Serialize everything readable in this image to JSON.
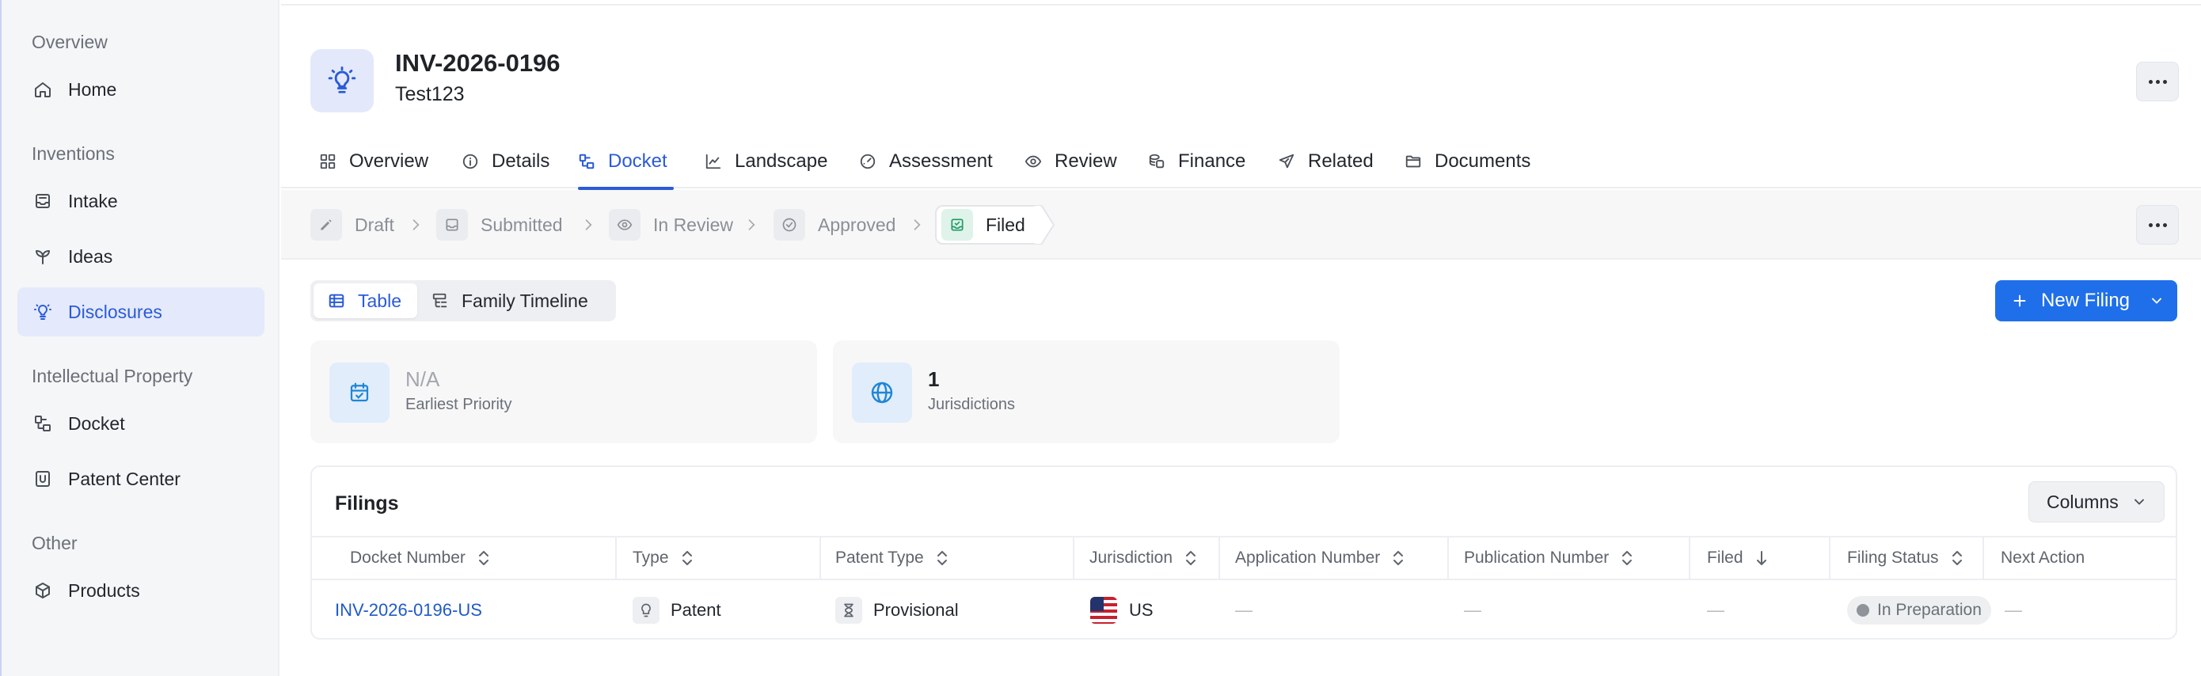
{
  "sidebar": {
    "sections": [
      "Overview",
      "Inventions",
      "Intellectual Property",
      "Other"
    ],
    "items": [
      {
        "label": "Home",
        "icon": "home-icon"
      },
      {
        "label": "Intake",
        "icon": "inbox-icon"
      },
      {
        "label": "Ideas",
        "icon": "sprout-icon"
      },
      {
        "label": "Disclosures",
        "icon": "lightbulb-icon",
        "active": true
      },
      {
        "label": "Docket",
        "icon": "docket-icon"
      },
      {
        "label": "Patent Center",
        "icon": "patent-center-icon"
      },
      {
        "label": "Products",
        "icon": "box-icon"
      }
    ]
  },
  "header": {
    "title": "INV-2026-0196",
    "subtitle": "Test123"
  },
  "tabs": [
    {
      "label": "Overview"
    },
    {
      "label": "Details"
    },
    {
      "label": "Docket",
      "active": true
    },
    {
      "label": "Landscape"
    },
    {
      "label": "Assessment"
    },
    {
      "label": "Review"
    },
    {
      "label": "Finance"
    },
    {
      "label": "Related"
    },
    {
      "label": "Documents"
    }
  ],
  "workflow": {
    "steps": [
      "Draft",
      "Submitted",
      "In Review",
      "Approved",
      "Filed"
    ],
    "current_step": "Filed"
  },
  "view_toggle": {
    "table_label": "Table",
    "timeline_label": "Family Timeline",
    "selected": "Table"
  },
  "new_filing_label": "New Filing",
  "stats": [
    {
      "value": "N/A",
      "label": "Earliest Priority"
    },
    {
      "value": "1",
      "label": "Jurisdictions"
    }
  ],
  "filings": {
    "title": "Filings",
    "columns_label": "Columns",
    "headers": [
      "Docket Number",
      "Type",
      "Patent Type",
      "Jurisdiction",
      "Application Number",
      "Publication Number",
      "Filed",
      "Filing Status",
      "Next Action"
    ],
    "rows": [
      {
        "docket_number": "INV-2026-0196-US",
        "type": "Patent",
        "patent_type": "Provisional",
        "jurisdiction": "US",
        "application_number": "—",
        "publication_number": "—",
        "filed": "—",
        "filing_status": "In Preparation",
        "next_action": "—"
      }
    ]
  },
  "colors": {
    "accent": "#2a5bd7",
    "primary_button": "#1f6feb",
    "filed_step": "#1f9a63"
  }
}
